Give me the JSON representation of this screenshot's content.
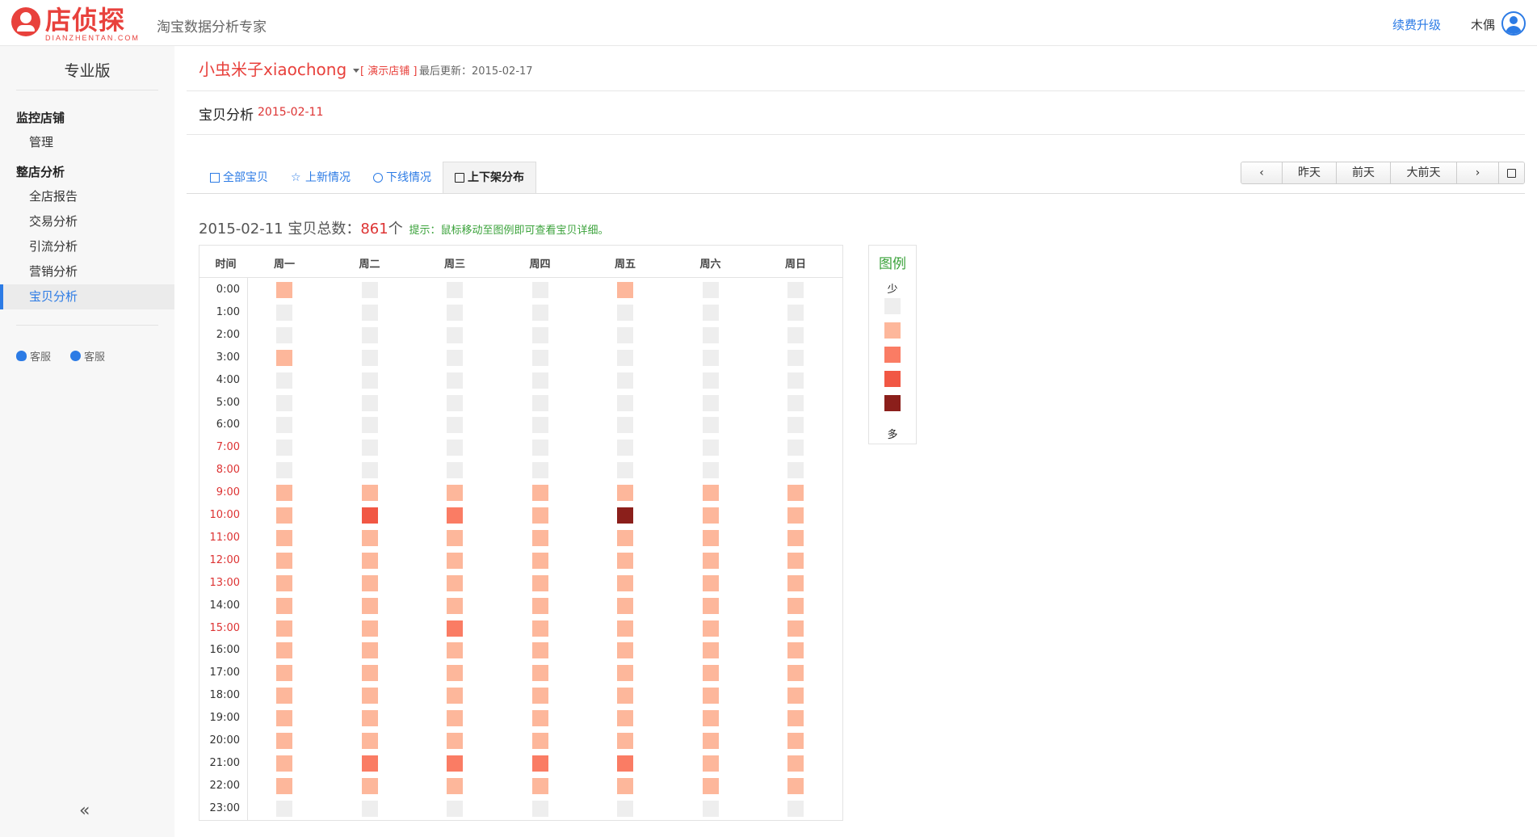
{
  "header": {
    "logo_name": "店侦探",
    "logo_sub": "DIANZHENTAN.COM",
    "slogan": "淘宝数据分析专家",
    "upgrade": "续费升级",
    "username": "木偶"
  },
  "sidebar": {
    "edition": "专业版",
    "group1": "监控店铺",
    "group1_items": [
      "管理"
    ],
    "group2": "整店分析",
    "group2_items": [
      "全店报告",
      "交易分析",
      "引流分析",
      "营销分析",
      "宝贝分析"
    ],
    "active_item": "宝贝分析",
    "kefu1": "客服",
    "kefu2": "客服",
    "collapse": "«"
  },
  "shop": {
    "name": "小虫米子xiaochong",
    "demo_tag": "[ 演示店铺 ]",
    "last_update": "最后更新：2015-02-17"
  },
  "page": {
    "title": "宝贝分析",
    "date": "2015-02-11"
  },
  "tabs": [
    {
      "label": "全部宝贝",
      "icon": "gift-icon"
    },
    {
      "label": "上新情况",
      "icon": "star-icon"
    },
    {
      "label": "下线情况",
      "icon": "clock-icon"
    },
    {
      "label": "上下架分布",
      "icon": "calendar-icon"
    }
  ],
  "active_tab": 3,
  "date_nav": {
    "prev": "‹",
    "yesterday": "昨天",
    "day_before": "前天",
    "three_days": "大前天",
    "next": "›",
    "calendar": "calendar-icon"
  },
  "summary": {
    "date": "2015-02-11",
    "label": "宝贝总数：",
    "count": "861",
    "unit": "个",
    "hint": "提示：鼠标移动至图例即可查看宝贝详细。"
  },
  "colors": {
    "level0": "#eeeeee",
    "level1": "#fdb79b",
    "level2": "#fa7c64",
    "level3": "#f15744",
    "level4": "#8b1f1b",
    "accent": "#2c7be5",
    "brand": "#e8413c"
  },
  "chart_data": {
    "type": "heatmap",
    "x_label": "时间",
    "columns": [
      "周一",
      "周二",
      "周三",
      "周四",
      "周五",
      "周六",
      "周日"
    ],
    "rows": [
      "0:00",
      "1:00",
      "2:00",
      "3:00",
      "4:00",
      "5:00",
      "6:00",
      "7:00",
      "8:00",
      "9:00",
      "10:00",
      "11:00",
      "12:00",
      "13:00",
      "14:00",
      "15:00",
      "16:00",
      "17:00",
      "18:00",
      "19:00",
      "20:00",
      "21:00",
      "22:00",
      "23:00"
    ],
    "highlight_rows": [
      "7:00",
      "8:00",
      "9:00",
      "10:00",
      "11:00",
      "12:00",
      "13:00",
      "15:00"
    ],
    "levels": [
      [
        1,
        0,
        0,
        0,
        1,
        0,
        0
      ],
      [
        0,
        0,
        0,
        0,
        0,
        0,
        0
      ],
      [
        0,
        0,
        0,
        0,
        0,
        0,
        0
      ],
      [
        1,
        0,
        0,
        0,
        0,
        0,
        0
      ],
      [
        0,
        0,
        0,
        0,
        0,
        0,
        0
      ],
      [
        0,
        0,
        0,
        0,
        0,
        0,
        0
      ],
      [
        0,
        0,
        0,
        0,
        0,
        0,
        0
      ],
      [
        0,
        0,
        0,
        0,
        0,
        0,
        0
      ],
      [
        0,
        0,
        0,
        0,
        0,
        0,
        0
      ],
      [
        1,
        1,
        1,
        1,
        1,
        1,
        1
      ],
      [
        1,
        3,
        2,
        1,
        4,
        1,
        1
      ],
      [
        1,
        1,
        1,
        1,
        1,
        1,
        1
      ],
      [
        1,
        1,
        1,
        1,
        1,
        1,
        1
      ],
      [
        1,
        1,
        1,
        1,
        1,
        1,
        1
      ],
      [
        1,
        1,
        1,
        1,
        1,
        1,
        1
      ],
      [
        1,
        1,
        2,
        1,
        1,
        1,
        1
      ],
      [
        1,
        1,
        1,
        1,
        1,
        1,
        1
      ],
      [
        1,
        1,
        1,
        1,
        1,
        1,
        1
      ],
      [
        1,
        1,
        1,
        1,
        1,
        1,
        1
      ],
      [
        1,
        1,
        1,
        1,
        1,
        1,
        1
      ],
      [
        1,
        1,
        1,
        1,
        1,
        1,
        1
      ],
      [
        1,
        2,
        2,
        2,
        2,
        1,
        1
      ],
      [
        1,
        1,
        1,
        1,
        1,
        1,
        1
      ],
      [
        0,
        0,
        0,
        0,
        0,
        0,
        0
      ]
    ],
    "legend": {
      "title": "图例",
      "low": "少",
      "high": "多",
      "levels": [
        0,
        1,
        2,
        3,
        4
      ]
    }
  }
}
